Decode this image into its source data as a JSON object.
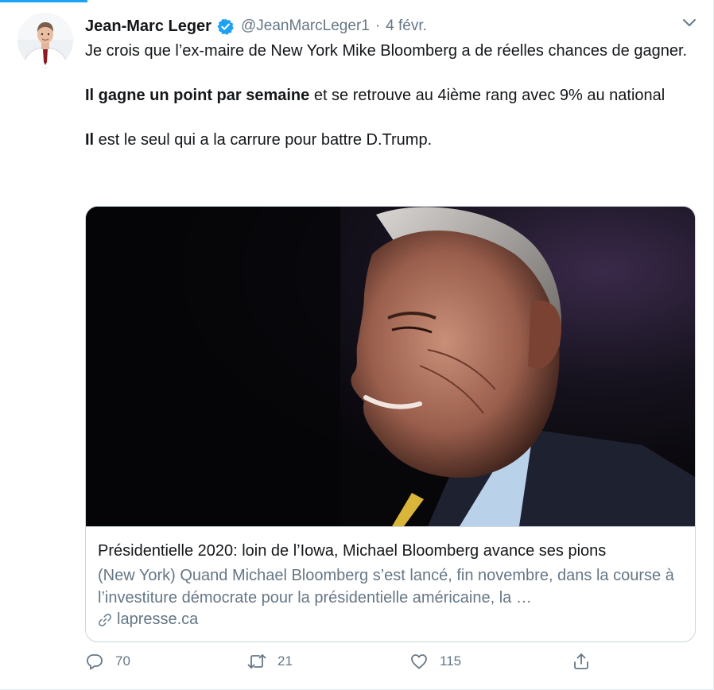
{
  "tweet": {
    "author_name": "Jean-Marc Leger",
    "handle": "@JeanMarcLeger1",
    "separator": "·",
    "date": "4 févr.",
    "paragraph1": "Je crois que l’ex-maire de New York Mike Bloomberg a de réelles chances de gagner.",
    "paragraph2_bold": "Il gagne un point par semaine",
    "paragraph2_rest": " et se retrouve au 4ième rang avec 9% au national",
    "paragraph3_bold": "Il",
    "paragraph3_rest": " est le seul qui a la carrure pour battre D.Trump."
  },
  "card": {
    "title": "Présidentielle 2020: loin de l’Iowa, Michael Bloomberg avance ses pions",
    "description": "(New York) Quand Michael Bloomberg s’est lancé, fin novembre, dans la course à l’investiture démocrate pour la présidentielle américaine, la …",
    "domain": "lapresse.ca"
  },
  "actions": {
    "reply_count": "70",
    "retweet_count": "21",
    "like_count": "115"
  },
  "colors": {
    "accent": "#1da1f2",
    "text": "#14171a",
    "secondary": "#657786",
    "border": "#ccd6dd"
  },
  "icons": [
    "verified-badge-icon",
    "chevron-down-icon",
    "link-icon",
    "reply-icon",
    "retweet-icon",
    "like-icon",
    "share-icon"
  ]
}
